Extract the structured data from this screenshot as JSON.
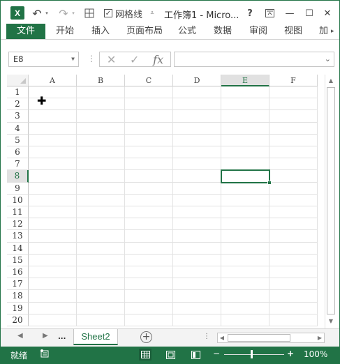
{
  "titlebar": {
    "app_icon": "excel-logo-icon",
    "app_letter": "X",
    "undo_icon": "undo-icon",
    "redo_icon": "redo-icon",
    "borders_icon": "borders-grid-icon",
    "gridlines_label": "网格线",
    "gridlines_checked": true,
    "customize_icon": "customize-qat-icon",
    "title": "工作簿1 - Micro...",
    "help": "?",
    "restore_ribbon_icon": "ribbon-display-icon",
    "minimize": "—",
    "maximize": "☐",
    "close": "✕"
  },
  "ribbon": {
    "tabs": [
      "文件",
      "开始",
      "插入",
      "页面布局",
      "公式",
      "数据",
      "审阅",
      "视图",
      "加"
    ]
  },
  "formula_bar": {
    "name_box": "E8",
    "cancel_icon": "✕",
    "enter_icon": "✓",
    "fx": "fx",
    "formula": ""
  },
  "grid": {
    "columns": [
      "A",
      "B",
      "C",
      "D",
      "E",
      "F"
    ],
    "rows": [
      "1",
      "2",
      "3",
      "4",
      "5",
      "6",
      "7",
      "8",
      "9",
      "10",
      "11",
      "12",
      "13",
      "14",
      "15",
      "16",
      "17",
      "18",
      "19",
      "20"
    ],
    "active_column": "E",
    "active_row": "8",
    "selection": "E8",
    "cursor_icon": "cell-select-cursor-icon"
  },
  "sheets": {
    "prev": "◀",
    "next": "▶",
    "ellipsis": "...",
    "tabs": [
      "Sheet2"
    ],
    "active": "Sheet2",
    "add_label": "+"
  },
  "status": {
    "ready": "就绪",
    "macro_icon": "macro-record-icon",
    "zoom_minus": "−",
    "zoom_plus": "+",
    "zoom": "100%",
    "zoom_level_percent": 100
  },
  "colors": {
    "accent": "#217346",
    "header_active": "#e1e1e1"
  }
}
